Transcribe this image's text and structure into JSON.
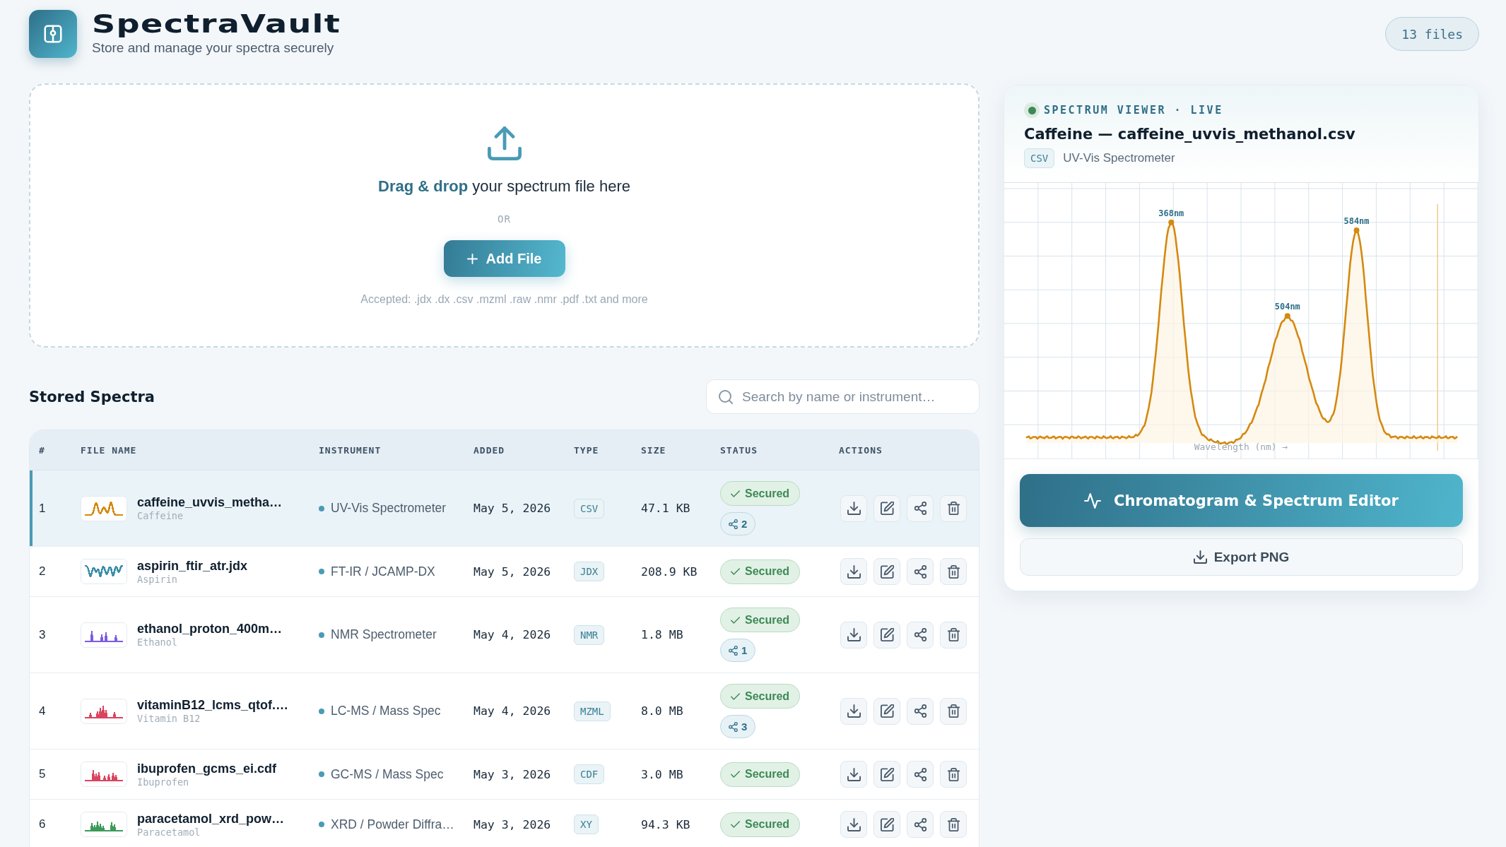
{
  "header": {
    "title": "SpectraVault",
    "subtitle": "Store and manage your spectra securely",
    "file_count": "13 files"
  },
  "upload": {
    "prompt": "**Drag & drop** your spectrum file here",
    "separator": "OR",
    "button": "Add File",
    "accepted": "Accepted: .jdx .dx .csv .mzml .raw .nmr .pdf .txt and more"
  },
  "library": {
    "title": "Stored Spectra",
    "search": {
      "placeholder": "Search by name or instrument…"
    },
    "table": {
      "columns": [
        "#",
        "FILE NAME",
        "INSTRUMENT",
        "ADDED",
        "TYPE",
        "SIZE",
        "STATUS",
        "ACTIONS"
      ],
      "rows": [
        {
          "index": "1",
          "file_name": "caffeine_uvvis_metha…",
          "compound": "Caffeine",
          "kind": "bands",
          "color": "#d4890f",
          "instrument": "UV-Vis Spectrometer",
          "added": "May 5, 2026",
          "type": "CSV",
          "size": "47.1 KB",
          "status": "Secured",
          "shares": "2",
          "selected": true
        },
        {
          "index": "2",
          "file_name": "aspirin_ftir_atr.jdx",
          "compound": "Aspirin",
          "kind": "dips",
          "color": "#3a8fa8",
          "instrument": "FT-IR / JCAMP-DX",
          "added": "May 5, 2026",
          "type": "JDX",
          "size": "208.9 KB",
          "status": "Secured",
          "selected": false
        },
        {
          "index": "3",
          "file_name": "ethanol_proton_400m…",
          "compound": "Ethanol",
          "kind": "spikes",
          "color": "#7b5ce0",
          "instrument": "NMR Spectrometer",
          "added": "May 4, 2026",
          "type": "NMR",
          "size": "1.8 MB",
          "status": "Secured",
          "shares": "1",
          "selected": false
        },
        {
          "index": "4",
          "file_name": "vitaminB12_lcms_qtof.…",
          "compound": "Vitamin B12",
          "kind": "spikes",
          "color": "#d9455f",
          "instrument": "LC-MS / Mass Spec",
          "added": "May 4, 2026",
          "type": "MZML",
          "size": "8.0 MB",
          "status": "Secured",
          "shares": "3",
          "selected": false
        },
        {
          "index": "5",
          "file_name": "ibuprofen_gcms_ei.cdf",
          "compound": "Ibuprofen",
          "kind": "spikes",
          "color": "#d9455f",
          "instrument": "GC-MS / Mass Spec",
          "added": "May 3, 2026",
          "type": "CDF",
          "size": "3.0 MB",
          "status": "Secured",
          "selected": false
        },
        {
          "index": "6",
          "file_name": "paracetamol_xrd_pow…",
          "compound": "Paracetamol",
          "kind": "spikes",
          "color": "#3d9a5a",
          "instrument": "XRD / Powder Diffra…",
          "added": "May 3, 2026",
          "type": "XY",
          "size": "94.3 KB",
          "status": "Secured",
          "selected": false
        }
      ]
    }
  },
  "viewer": {
    "label": "SPECTRUM VIEWER · LIVE",
    "live": true,
    "title": "Caffeine — caffeine_uvvis_methanol.csv",
    "type": "CSV",
    "instrument": "UV-Vis Spectrometer",
    "chart": {
      "peak_labels": [
        "368nm",
        "504nm",
        "584nm"
      ],
      "axis_label": "Wavelength (nm) →"
    },
    "editor_button": "Chromatogram & Spectrum Editor",
    "export_button": "Export PNG"
  }
}
